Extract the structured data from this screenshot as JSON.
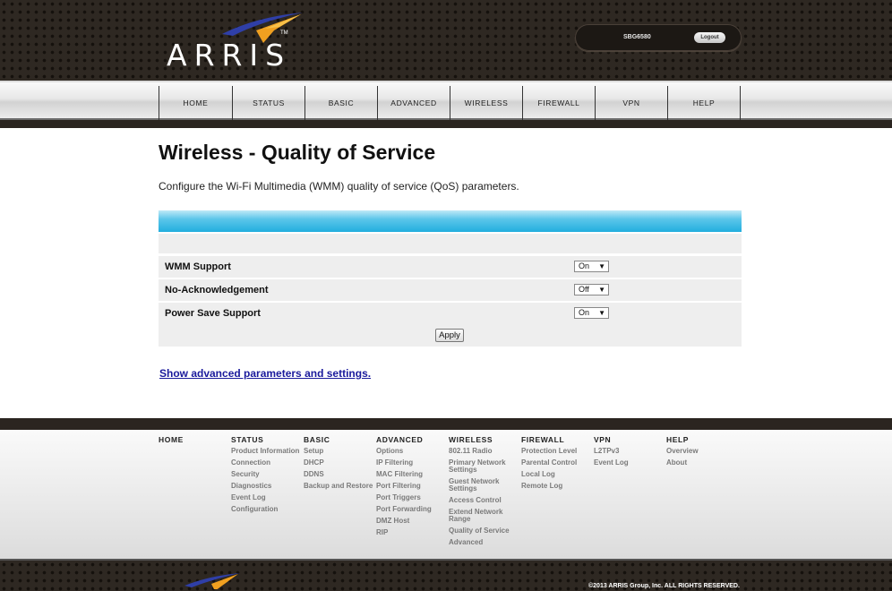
{
  "header": {
    "brand": "ARRIS",
    "trademark": "TM",
    "model": "SBG6580",
    "logout_label": "Logout"
  },
  "nav": {
    "items": [
      "HOME",
      "STATUS",
      "BASIC",
      "ADVANCED",
      "WIRELESS",
      "FIREWALL",
      "VPN",
      "HELP"
    ]
  },
  "main": {
    "title": "Wireless - Quality of Service",
    "description": "Configure the Wi-Fi Multimedia (WMM) quality of service (QoS) parameters.",
    "settings": [
      {
        "label": "WMM Support",
        "value": "On"
      },
      {
        "label": "No-Acknowledgement",
        "value": "Off"
      },
      {
        "label": "Power Save Support",
        "value": "On"
      }
    ],
    "apply_label": "Apply",
    "advanced_link": "Show advanced parameters and settings."
  },
  "sitemap": {
    "home": {
      "heading": "HOME",
      "links": []
    },
    "status": {
      "heading": "STATUS",
      "links": [
        "Product Information",
        "Connection",
        "Security",
        "Diagnostics",
        "Event Log",
        "Configuration"
      ]
    },
    "basic": {
      "heading": "BASIC",
      "links": [
        "Setup",
        "DHCP",
        "DDNS",
        "Backup and Restore"
      ]
    },
    "advanced": {
      "heading": "ADVANCED",
      "links": [
        "Options",
        "IP Filtering",
        "MAC Filtering",
        "Port Filtering",
        "Port Triggers",
        "Port Forwarding",
        "DMZ Host",
        "RIP"
      ]
    },
    "wireless": {
      "heading": "WIRELESS",
      "links": [
        "802.11 Radio",
        "Primary Network Settings",
        "Guest Network Settings",
        "Access Control",
        "Extend Network Range",
        "Quality of Service",
        "Advanced"
      ]
    },
    "firewall": {
      "heading": "FIREWALL",
      "links": [
        "Protection Level",
        "Parental Control",
        "Local Log",
        "Remote Log"
      ]
    },
    "vpn": {
      "heading": "VPN",
      "links": [
        "L2TPv3",
        "Event Log"
      ]
    },
    "help": {
      "heading": "HELP",
      "links": [
        "Overview",
        "About"
      ]
    }
  },
  "footer": {
    "copyright": "©2013 ARRIS Group, Inc. ALL RIGHTS RESERVED."
  },
  "colors": {
    "header_bg": "#2e2822",
    "table_header": "#22aede",
    "link": "#1a1a9c",
    "swoosh_blue": "#2f3fa8",
    "swoosh_orange": "#f0a020"
  }
}
